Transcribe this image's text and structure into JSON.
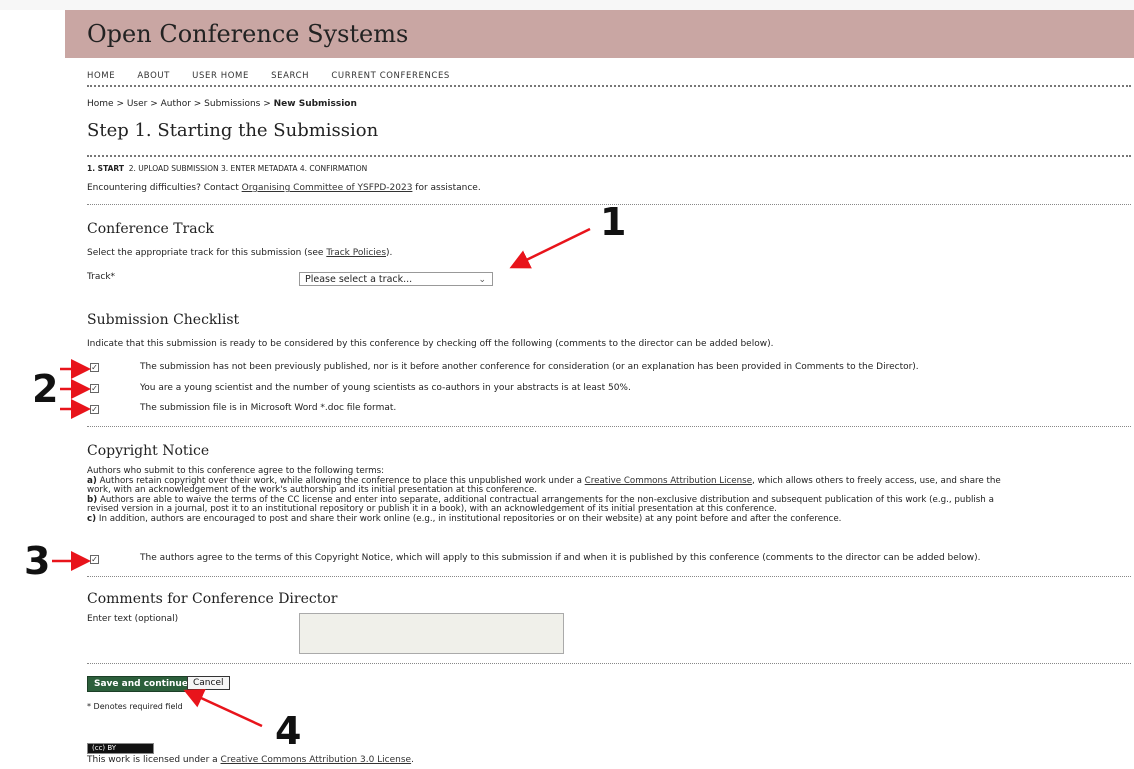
{
  "header": {
    "title": "Open Conference Systems"
  },
  "nav": {
    "items": [
      "HOME",
      "ABOUT",
      "USER HOME",
      "SEARCH",
      "CURRENT CONFERENCES"
    ]
  },
  "breadcrumb": {
    "prefix": "Home > User > Author > Submissions > ",
    "current": "New Submission"
  },
  "page": {
    "title": "Step 1. Starting the Submission"
  },
  "steps": {
    "current": "1. START",
    "rest": "2. UPLOAD SUBMISSION  3. ENTER METADATA  4. CONFIRMATION"
  },
  "help": {
    "prefix": "Encountering difficulties? Contact ",
    "link": "Organising Committee of YSFPD-2023",
    "suffix": " for assistance."
  },
  "track": {
    "heading": "Conference Track",
    "desc_prefix": "Select the appropriate track for this submission (see ",
    "desc_link": "Track Policies",
    "desc_suffix": ").",
    "label": "Track*",
    "select_value": "Please select a track..."
  },
  "checklist": {
    "heading": "Submission Checklist",
    "desc": "Indicate that this submission is ready to be considered by this conference by checking off the following (comments to the director can be added below).",
    "items": [
      "The submission has not been previously published, nor is it before another conference for consideration (or an explanation has been provided in Comments to the Director).",
      "You are a young scientist and the number of young scientists as co-authors in your abstracts is at least 50%.",
      "The submission file is in Microsoft Word *.doc file format."
    ],
    "checked": [
      true,
      true,
      true
    ]
  },
  "copyright": {
    "heading": "Copyright Notice",
    "intro": "Authors who submit to this conference agree to the following terms:",
    "a_label": "a)",
    "a_text1": " Authors retain copyright over their work, while allowing the conference to place this unpublished work under a ",
    "a_link": "Creative Commons Attribution License",
    "a_text2": ", which allows others to freely access, use, and share the",
    "a_line2": "work, with an acknowledgement of the work's authorship and its initial presentation at this conference.",
    "b_label": "b)",
    "b_text1": " Authors are able to waive the terms of the CC license and enter into separate, additional contractual arrangements for the non-exclusive distribution and subsequent publication of this work (e.g., publish a",
    "b_line2": "revised version in a journal, post it to an institutional repository or publish it in a book), with an acknowledgement of its initial presentation at this conference.",
    "c_label": "c)",
    "c_text": " In addition, authors are encouraged to post and share their work online (e.g., in institutional repositories or on their website) at any point before and after the conference.",
    "agree": "The authors agree to the terms of this Copyright Notice, which will apply to this submission if and when it is published by this conference (comments to the director can be added below).",
    "agree_checked": true
  },
  "comments": {
    "heading": "Comments for Conference Director",
    "label": "Enter text (optional)"
  },
  "actions": {
    "save": "Save and continue",
    "cancel": "Cancel",
    "required_note": "* Denotes required field"
  },
  "license": {
    "badge": "(cc) BY",
    "prefix": "This work is licensed under a ",
    "link": "Creative Commons Attribution 3.0 License",
    "suffix": "."
  },
  "annotations": [
    "1",
    "2",
    "3",
    "4"
  ],
  "colors": {
    "header_bg": "#c9a6a3",
    "arrow": "#e8141b",
    "primary_button": "#2c5f3b"
  }
}
